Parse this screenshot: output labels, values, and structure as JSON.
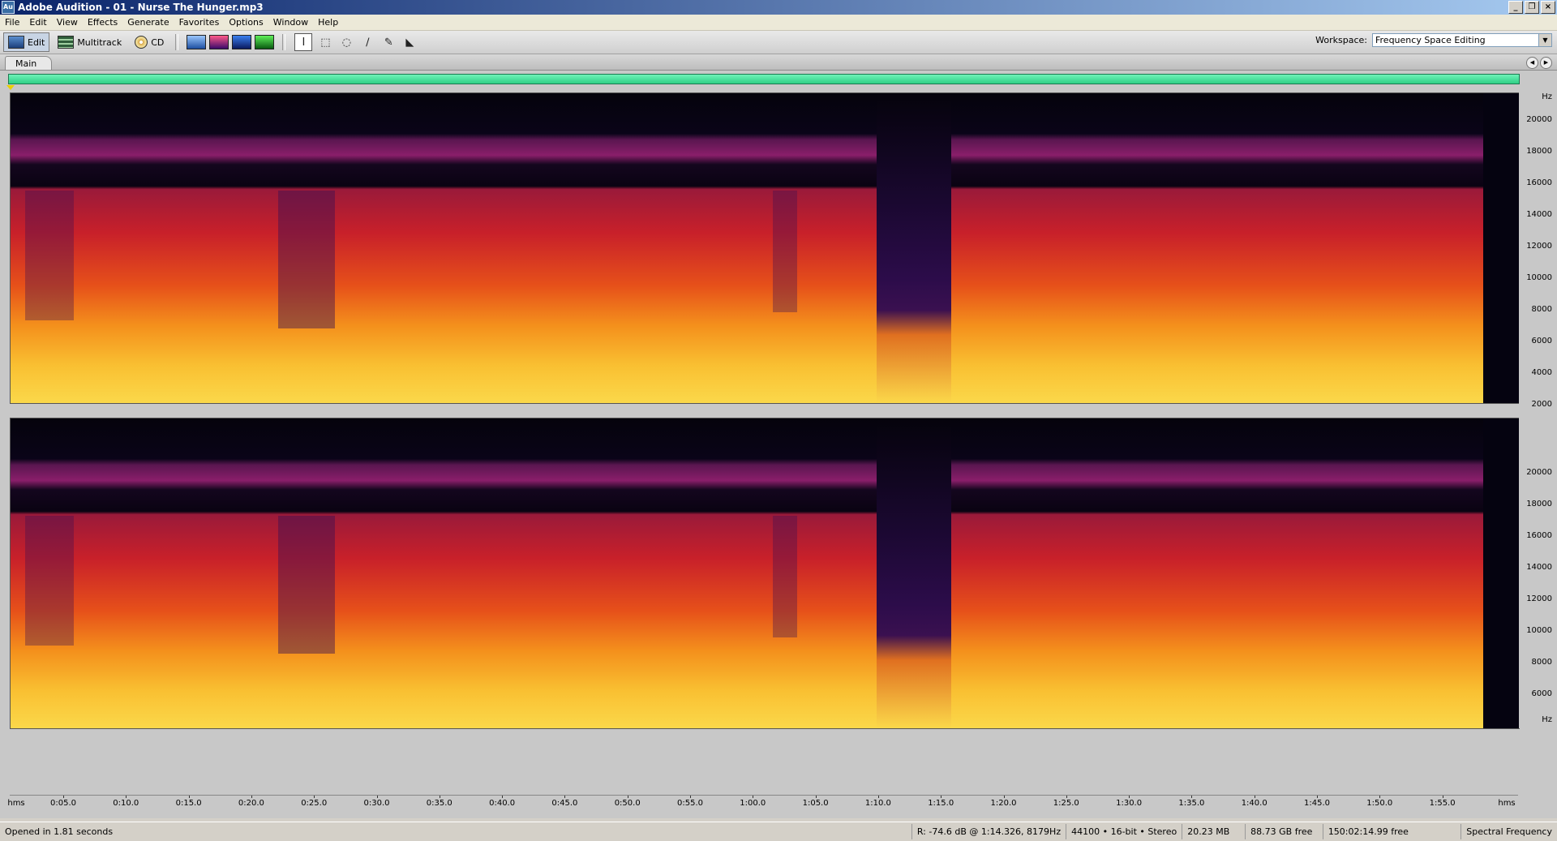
{
  "window": {
    "app_icon": "Au",
    "title": "Adobe Audition - 01 - Nurse The Hunger.mp3",
    "buttons": [
      "_",
      "❐",
      "×"
    ]
  },
  "menu": [
    "File",
    "Edit",
    "View",
    "Effects",
    "Generate",
    "Favorites",
    "Options",
    "Window",
    "Help"
  ],
  "toolbar": {
    "edit_label": "Edit",
    "multitrack_label": "Multitrack",
    "cd_label": "CD",
    "workspace_label": "Workspace:",
    "workspace_value": "Frequency Space Editing"
  },
  "panel": {
    "tab_label": "Main",
    "freq_unit": "Hz",
    "freq_labels": [
      "20000",
      "18000",
      "16000",
      "14000",
      "12000",
      "10000",
      "8000",
      "6000",
      "4000",
      "2000"
    ],
    "time_unit": "hms",
    "time_labels": [
      "0:05.0",
      "0:10.0",
      "0:15.0",
      "0:20.0",
      "0:25.0",
      "0:30.0",
      "0:35.0",
      "0:40.0",
      "0:45.0",
      "0:50.0",
      "0:55.0",
      "1:00.0",
      "1:05.0",
      "1:10.0",
      "1:15.0",
      "1:20.0",
      "1:25.0",
      "1:30.0",
      "1:35.0",
      "1:40.0",
      "1:45.0",
      "1:50.0",
      "1:55.0"
    ]
  },
  "status": {
    "message": "Opened in 1.81 seconds",
    "cursor": "R: -74.6 dB @  1:14.326, 8179Hz",
    "format": "44100 • 16-bit • Stereo",
    "file_size": "20.23 MB",
    "disk_free": "88.73 GB free",
    "time_free": "150:02:14.99 free",
    "view_mode": "Spectral Frequency"
  }
}
